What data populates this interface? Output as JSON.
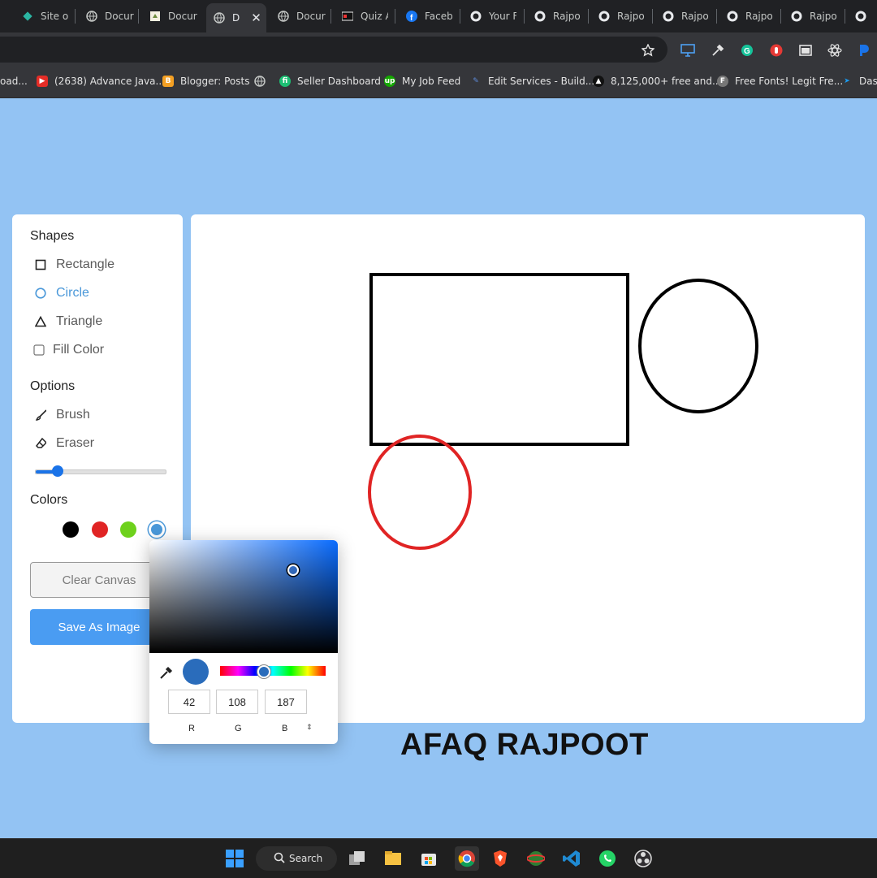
{
  "browser": {
    "tabs": [
      {
        "title": "Site o",
        "icon": "diamond-icon"
      },
      {
        "title": "Docur",
        "icon": "globe-icon"
      },
      {
        "title": "Docur",
        "icon": "doc-icon"
      },
      {
        "title": "D",
        "icon": "globe-icon",
        "active": true
      },
      {
        "title": "Docur",
        "icon": "globe-icon"
      },
      {
        "title": "Quiz A",
        "icon": "quiz-icon"
      },
      {
        "title": "Faceb",
        "icon": "facebook-icon"
      },
      {
        "title": "Your F",
        "icon": "github-icon"
      },
      {
        "title": "Rajpo",
        "icon": "github-icon"
      },
      {
        "title": "Rajpo",
        "icon": "github-icon"
      },
      {
        "title": "Rajpo",
        "icon": "github-icon"
      },
      {
        "title": "Rajpo",
        "icon": "github-icon"
      },
      {
        "title": "Rajpo",
        "icon": "github-icon"
      },
      {
        "title": "",
        "icon": "github-icon"
      }
    ],
    "bookmarks": [
      {
        "label": "oad...",
        "icon": "none"
      },
      {
        "label": "(2638) Advance Java...",
        "icon": "youtube-icon",
        "color": "#e52d27"
      },
      {
        "label": "Blogger: Posts",
        "icon": "blogger-icon",
        "color": "#f4a023"
      },
      {
        "label": "",
        "icon": "globe-icon",
        "color": "#9aa0a6"
      },
      {
        "label": "Seller Dashboard",
        "icon": "fiverr-icon",
        "color": "#1dbf73"
      },
      {
        "label": "My Job Feed",
        "icon": "upwork-icon",
        "color": "#14a800"
      },
      {
        "label": "Edit Services - Build...",
        "icon": "edit-icon",
        "color": "#5f8ad9"
      },
      {
        "label": "8,125,000+ free and...",
        "icon": "vector-icon",
        "color": "#222"
      },
      {
        "label": "Free Fonts! Legit Fre...",
        "icon": "fonts-icon",
        "color": "#777"
      },
      {
        "label": "Dasl",
        "icon": "dash-icon",
        "color": "#1a9bf0"
      }
    ]
  },
  "sidebar": {
    "shapes_title": "Shapes",
    "shapes": [
      {
        "label": "Rectangle",
        "icon": "square-icon",
        "selected": false
      },
      {
        "label": "Circle",
        "icon": "circle-icon",
        "selected": true
      },
      {
        "label": "Triangle",
        "icon": "triangle-icon",
        "selected": false
      }
    ],
    "fill_color_label": "Fill Color",
    "options_title": "Options",
    "brush_label": "Brush",
    "eraser_label": "Eraser",
    "brush_size_fraction": 0.17,
    "colors_title": "Colors",
    "colors": [
      "#000000",
      "#e02424",
      "#6ed11c",
      "#4a98d9"
    ],
    "clear_label": "Clear Canvas",
    "save_label": "Save As Image"
  },
  "heading": "AFAQ RAJPOOT",
  "picker": {
    "r": "42",
    "g": "108",
    "b": "187",
    "r_label": "R",
    "g_label": "G",
    "b_label": "B",
    "current_color": "#2a6cbb"
  },
  "taskbar": {
    "search_label": "Search"
  }
}
